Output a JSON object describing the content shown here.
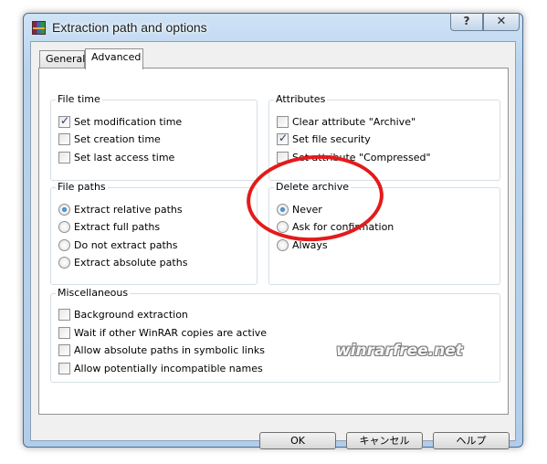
{
  "window": {
    "title": "Extraction path and options",
    "help_label": "?",
    "close_label": "✕"
  },
  "tabs": [
    {
      "label": "General",
      "selected": false
    },
    {
      "label": "Advanced",
      "selected": true
    }
  ],
  "file_time": {
    "title": "File time",
    "options": [
      {
        "label": "Set modification time",
        "checked": true
      },
      {
        "label": "Set creation time",
        "checked": false
      },
      {
        "label": "Set last access time",
        "checked": false
      }
    ]
  },
  "attributes": {
    "title": "Attributes",
    "options": [
      {
        "label": "Clear attribute \"Archive\"",
        "checked": false
      },
      {
        "label": "Set file security",
        "checked": true
      },
      {
        "label": "Set attribute \"Compressed\"",
        "checked": false
      }
    ]
  },
  "file_paths": {
    "title": "File paths",
    "options": [
      {
        "label": "Extract relative paths",
        "selected": true
      },
      {
        "label": "Extract full paths",
        "selected": false
      },
      {
        "label": "Do not extract paths",
        "selected": false
      },
      {
        "label": "Extract absolute paths",
        "selected": false
      }
    ]
  },
  "delete_archive": {
    "title": "Delete archive",
    "options": [
      {
        "label": "Never",
        "selected": true
      },
      {
        "label": "Ask for confirmation",
        "selected": false
      },
      {
        "label": "Always",
        "selected": false
      }
    ]
  },
  "miscellaneous": {
    "title": "Miscellaneous",
    "options": [
      {
        "label": "Background extraction",
        "checked": false
      },
      {
        "label": "Wait if other WinRAR copies are active",
        "checked": false
      },
      {
        "label": "Allow absolute paths in symbolic links",
        "checked": false
      },
      {
        "label": "Allow potentially incompatible names",
        "checked": false
      }
    ]
  },
  "buttons": {
    "ok": "OK",
    "cancel": "キャンセル",
    "help": "ヘルプ"
  },
  "watermark": "winrarfree.net",
  "colors": {
    "highlight": "#e31b1b",
    "titlebar": "#b9d3ee"
  }
}
